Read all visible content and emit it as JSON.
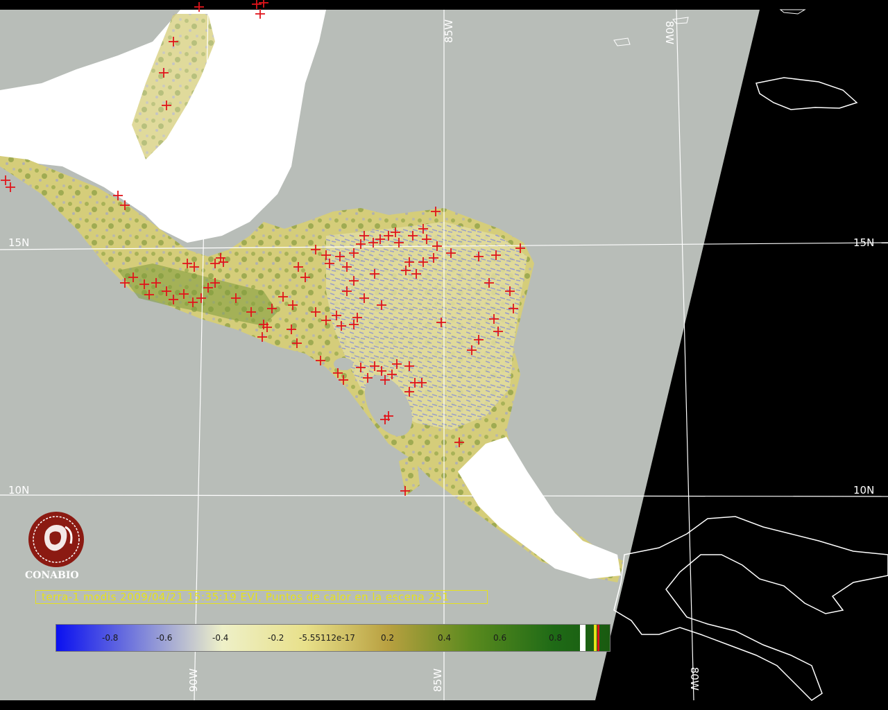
{
  "map": {
    "title": "terra-1 modis 2009/04/21 15:35:19 EVI, Puntos de calor en la escena 251",
    "grid_labels": {
      "lon_85w_top": "85W",
      "lon_80w_top": "80W",
      "lat_15n_left": "15N",
      "lat_15n_right": "15N",
      "lat_10n_left": "10N",
      "lat_10n_right": "10N",
      "lon_90w_bottom": "90W",
      "lon_85w_bottom": "85W",
      "lon_80w_bottom": "80W"
    },
    "logo": {
      "text": "CONABIO"
    },
    "colors": {
      "no_data": "#b8bdb8",
      "outside_swath": "#000000",
      "coastline": "#ffffff",
      "hotspot": "#e0151b",
      "cloud": "#ffffff",
      "grid": "#ffffff",
      "logo": "#8b1a12",
      "caption": "#e6e21c"
    },
    "colorbar": {
      "ticks": [
        "-0.8",
        "-0.6",
        "-0.4",
        "-0.2",
        "-5.55112e-17",
        "0.2",
        "0.4",
        "0.6",
        "0.8"
      ],
      "gradient_stops": [
        {
          "offset": 0.0,
          "color": "#0a10f0"
        },
        {
          "offset": 0.17,
          "color": "#8a90d8"
        },
        {
          "offset": 0.3,
          "color": "#eef0c8"
        },
        {
          "offset": 0.45,
          "color": "#e8e08a"
        },
        {
          "offset": 0.6,
          "color": "#b8a040"
        },
        {
          "offset": 0.75,
          "color": "#5a8a1e"
        },
        {
          "offset": 0.9,
          "color": "#1e6a16"
        },
        {
          "offset": 1.0,
          "color": "#1a5a10"
        }
      ]
    }
  }
}
